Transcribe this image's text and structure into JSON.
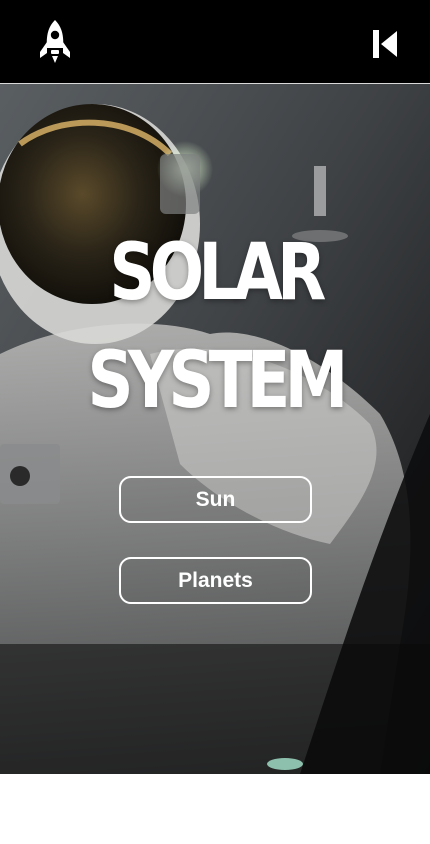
{
  "header": {
    "logo_icon": "rocket-icon",
    "back_icon": "skip-back-icon"
  },
  "hero": {
    "title_line1": "SOLAR",
    "title_line2": "SYSTEM",
    "background": "astronaut-photo"
  },
  "menu": {
    "sun_label": "Sun",
    "planets_label": "Planets"
  },
  "colors": {
    "topbar": "#000000",
    "text": "#ffffff",
    "button_border": "#ffffff"
  }
}
